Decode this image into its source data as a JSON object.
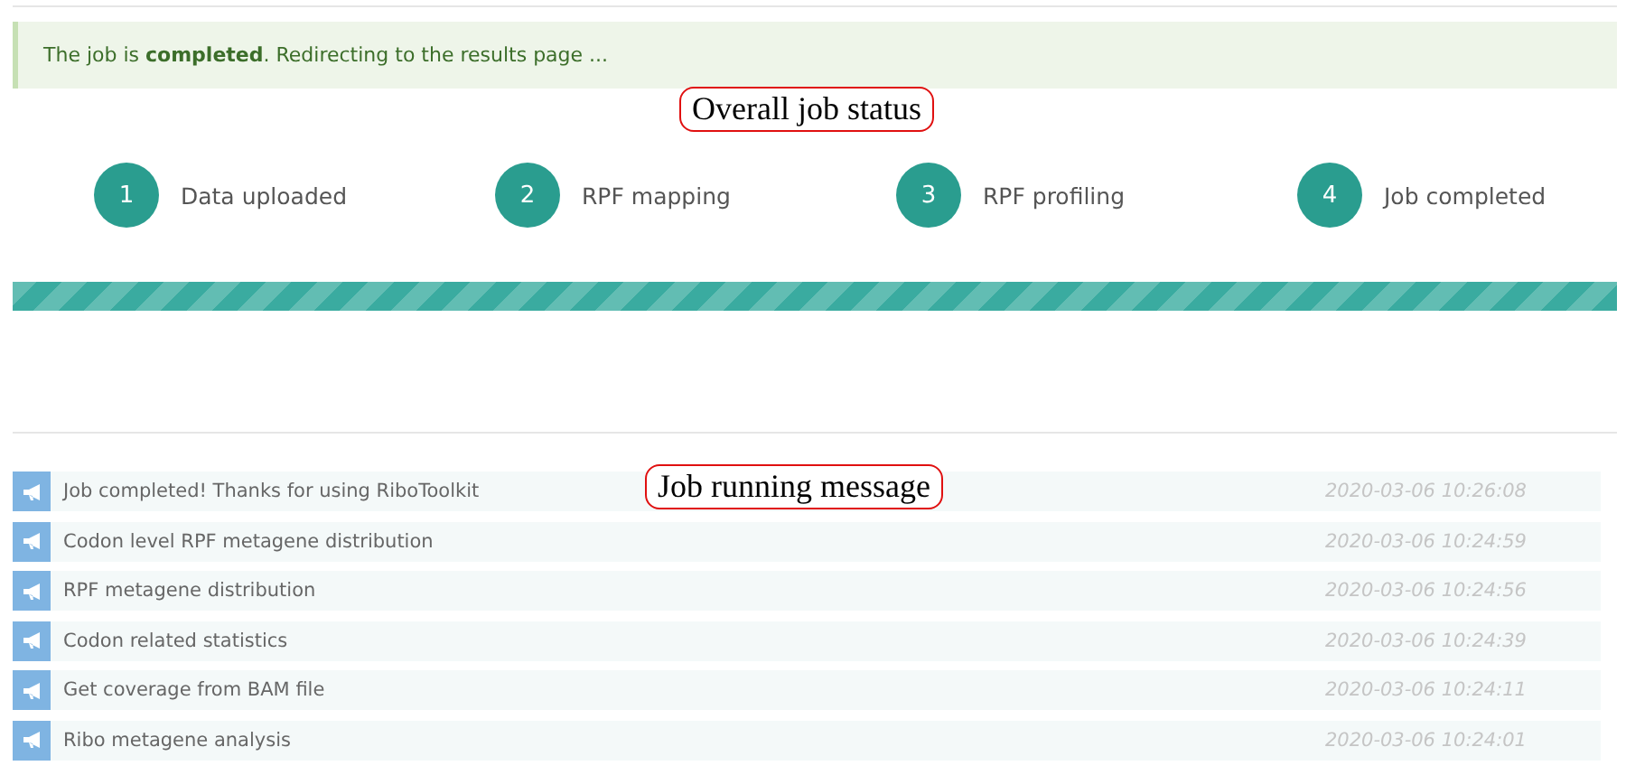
{
  "alert": {
    "text": "The job is **completed**. Redirecting to the results page ..."
  },
  "steps": [
    {
      "number": "1",
      "label": "Data uploaded"
    },
    {
      "number": "2",
      "label": "RPF mapping"
    },
    {
      "number": "3",
      "label": "RPF profiling"
    },
    {
      "number": "4",
      "label": "Job completed"
    }
  ],
  "progress": {
    "level": 1
  },
  "messages": [
    {
      "text": "Job completed! Thanks for using RiboToolkit",
      "time": "2020-03-06 10:26:08"
    },
    {
      "text": "Codon level RPF metagene distribution",
      "time": "2020-03-06 10:24:59"
    },
    {
      "text": "RPF metagene distribution",
      "time": "2020-03-06 10:24:56"
    },
    {
      "text": "Codon related statistics",
      "time": "2020-03-06 10:24:39"
    },
    {
      "text": "Get coverage from BAM file",
      "time": "2020-03-06 10:24:11"
    },
    {
      "text": "Ribo metagene analysis",
      "time": "2020-03-06 10:24:01"
    }
  ],
  "annotations": [
    {
      "text": "Overall job status"
    },
    {
      "text": "Job running message"
    }
  ]
}
